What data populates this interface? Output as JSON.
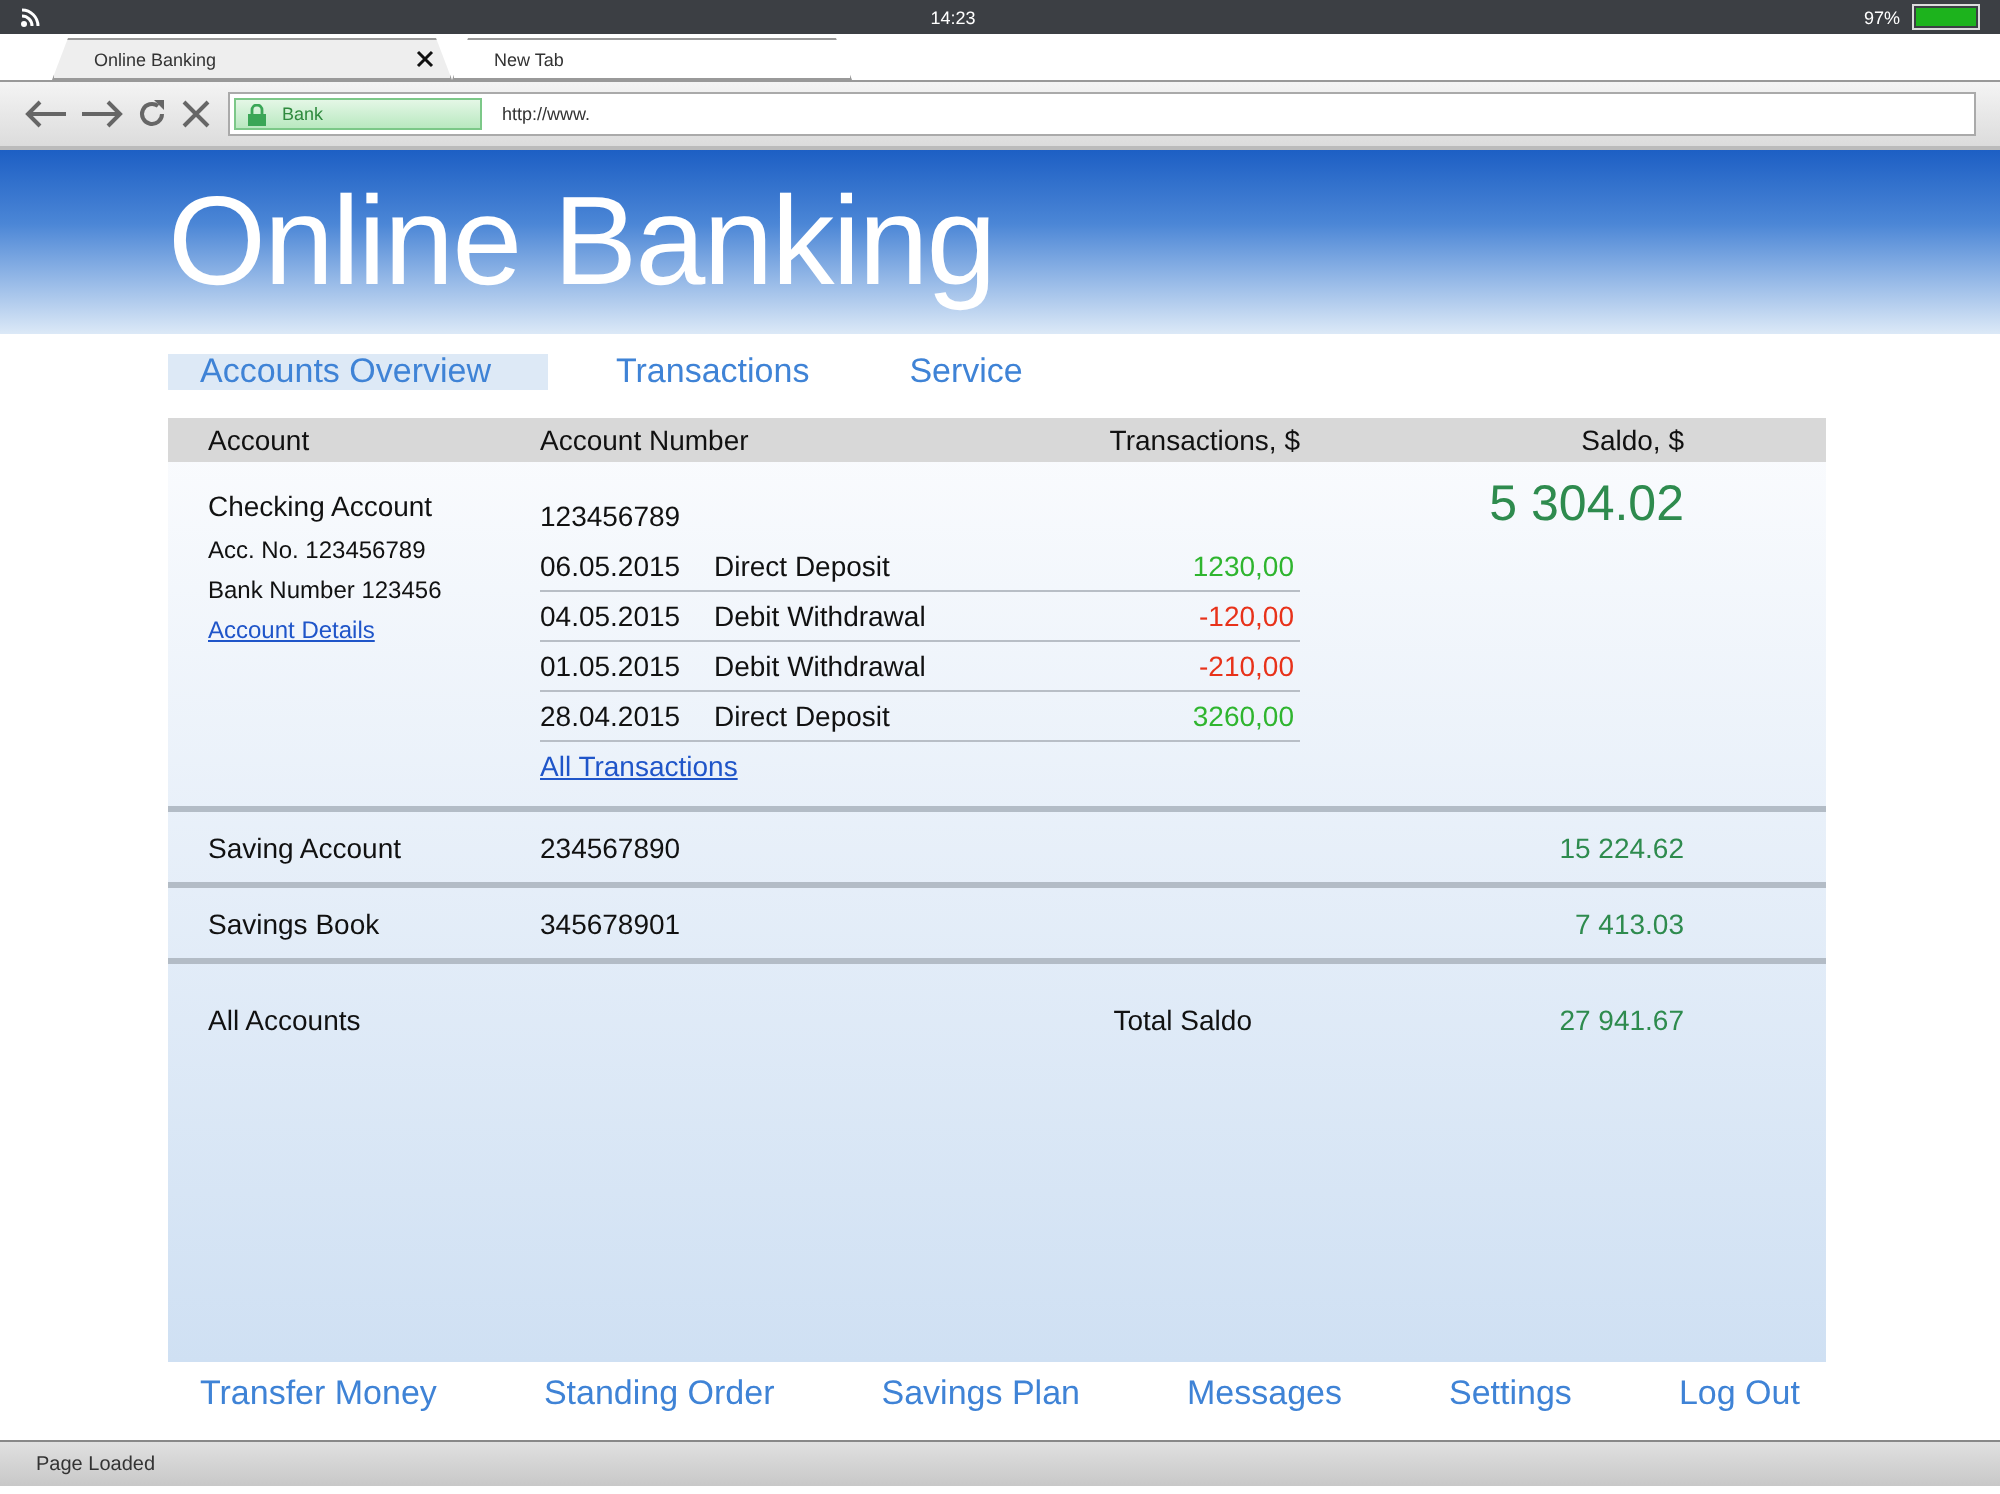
{
  "device_status": {
    "time": "14:23",
    "battery": "97%"
  },
  "browser": {
    "tabs": [
      {
        "label": "Online Banking",
        "selected": true
      },
      {
        "label": "New Tab",
        "selected": false
      }
    ],
    "address_bar": {
      "site_badge": "Bank",
      "url": "http://www."
    },
    "status_text": "Page Loaded"
  },
  "page": {
    "title": "Online Banking",
    "nav": [
      {
        "label": "Accounts Overview",
        "selected": true
      },
      {
        "label": "Transactions",
        "selected": false
      },
      {
        "label": "Service",
        "selected": false
      }
    ],
    "table": {
      "columns": [
        "Account",
        "Account Number",
        "Transactions, $",
        "Saldo, $"
      ],
      "checking": {
        "name": "Checking Account",
        "account_no": "Acc. No. 123456789",
        "bank_number": "Bank Number 123456",
        "details_link": "Account Details",
        "number": "123456789",
        "saldo": "5 304.02",
        "transactions": [
          {
            "date": "06.05.2015",
            "description": "Direct Deposit",
            "amount": "1230,00",
            "kind": "credit"
          },
          {
            "date": "04.05.2015",
            "description": "Debit Withdrawal",
            "amount": "-120,00",
            "kind": "debit"
          },
          {
            "date": "01.05.2015",
            "description": "Debit Withdrawal",
            "amount": "-210,00",
            "kind": "debit"
          },
          {
            "date": "28.04.2015",
            "description": "Direct Deposit",
            "amount": "3260,00",
            "kind": "credit"
          }
        ],
        "all_link": "All Transactions"
      },
      "accounts": [
        {
          "name": "Saving Account",
          "number": "234567890",
          "saldo": "15 224.62"
        },
        {
          "name": "Savings Book",
          "number": "345678901",
          "saldo": "7 413.03"
        }
      ],
      "total": {
        "label": "All Accounts",
        "total_label": "Total Saldo",
        "saldo": "27 941.67"
      }
    },
    "footer_nav": [
      "Transfer Money",
      "Standing Order",
      "Savings Plan",
      "Messages",
      "Settings",
      "Log Out"
    ]
  }
}
